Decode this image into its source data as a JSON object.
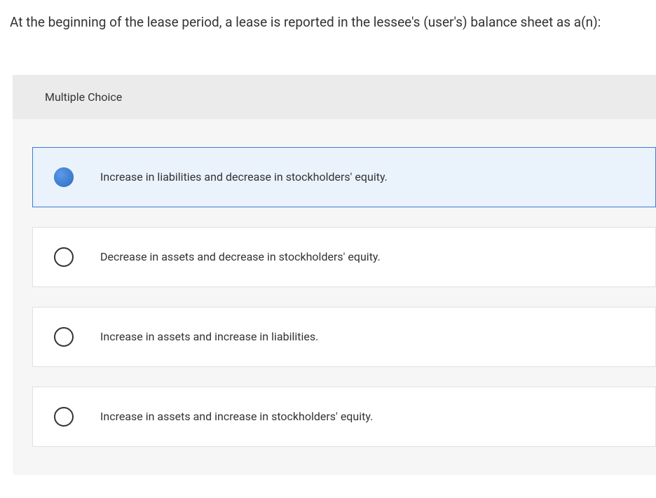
{
  "question": {
    "prompt": "At the beginning of the lease period, a lease is reported in the lessee's (user's) balance sheet as a(n):",
    "type_label": "Multiple Choice",
    "options": [
      {
        "text": "Increase in liabilities and decrease in stockholders' equity.",
        "selected": true
      },
      {
        "text": "Decrease in assets and decrease in stockholders' equity.",
        "selected": false
      },
      {
        "text": "Increase in assets and increase in liabilities.",
        "selected": false
      },
      {
        "text": "Increase in assets and increase in stockholders' equity.",
        "selected": false
      }
    ]
  }
}
